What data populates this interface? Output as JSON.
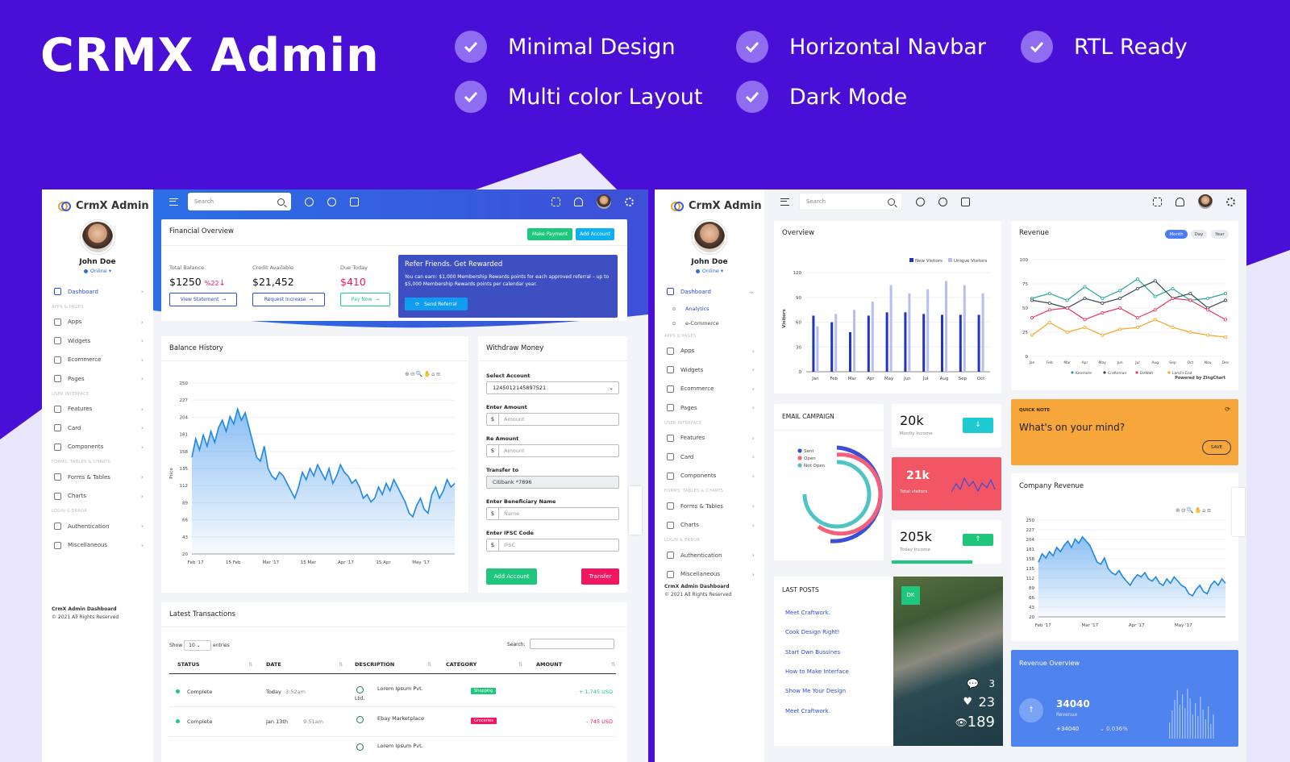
{
  "hero": {
    "title": "CRMX Admin",
    "features": [
      "Minimal Design",
      "Horizontal Navbar",
      "RTL Ready",
      "Multi color Layout",
      "Dark Mode"
    ]
  },
  "colors": {
    "brand": "#4a0fd6",
    "primary": "#2b4fd6",
    "success": "#1fc77e",
    "danger": "#f2155f",
    "info": "#0fb0f0"
  },
  "left": {
    "logo": "CrmX Admin",
    "user": {
      "name": "John Doe",
      "status": "Online ▾"
    },
    "search_placeholder": "Search",
    "nav": [
      {
        "label": "Dashboard",
        "active": true,
        "icon": "monitor-icon"
      },
      {
        "section": "APPS & PAGES"
      },
      {
        "label": "Apps",
        "icon": "grid-icon"
      },
      {
        "label": "Widgets",
        "icon": "edit-icon"
      },
      {
        "label": "Ecommerce",
        "icon": "cart-icon"
      },
      {
        "label": "Pages",
        "icon": "pages-icon"
      },
      {
        "section": "USER INTERFACE"
      },
      {
        "label": "Features",
        "icon": "box-icon"
      },
      {
        "label": "Card",
        "icon": "card-icon"
      },
      {
        "label": "Components",
        "icon": "eye-icon"
      },
      {
        "section": "FORMS, TABLES & CHARTS"
      },
      {
        "label": "Forms & Tables",
        "icon": "stack-icon"
      },
      {
        "label": "Charts",
        "icon": "pie-icon"
      },
      {
        "section": "LOGIN & ERROR"
      },
      {
        "label": "Authentication",
        "icon": "lock-icon"
      },
      {
        "label": "Miscellaneous",
        "icon": "warning-icon"
      }
    ],
    "footer": {
      "title": "CrmX Admin Dashboard",
      "copy": "© 2021 All Rights Reserved"
    },
    "financial": {
      "title": "Financial Overview",
      "make_payment": "Make Payment",
      "add_account": "Add Account",
      "total_label": "Total Balance",
      "total_value": "$1250",
      "total_change": "%22",
      "credit_label": "Credit Available",
      "credit_value": "$21,452",
      "due_label": "Due Today",
      "due_value": "$410",
      "view_statement": "View Statement",
      "request_increase": "Request Increase",
      "pay_now": "Pay Now"
    },
    "refer": {
      "title": "Refer Friends. Get Rewarded",
      "text": "You can earn: $1,000 Membership Rewards points for each approved referral – up to $5,000 Membership Rewards points per calendar year.",
      "button": "Send Referral"
    },
    "balance": {
      "title": "Balance History",
      "ylabel": "Price"
    },
    "withdraw": {
      "title": "Withdraw Money",
      "select_label": "Select Account",
      "select_value": "1245012145897521",
      "amount_label": "Enter Amount",
      "amount_ph": "Amount",
      "reamount_label": "Re Amount",
      "reamount_ph": "Amount",
      "transfer_label": "Transfer to",
      "transfer_value": "Citibank *7896",
      "beneficiary_label": "Enter Beneficiary Name",
      "beneficiary_ph": "Name",
      "ifsc_label": "Enter IFSC Code",
      "ifsc_ph": "IFSC",
      "add_btn": "Add Account",
      "transfer_btn": "Transfer",
      "currency": "$"
    },
    "transactions": {
      "title": "Latest Transactions",
      "show": "Show",
      "entries": "entries",
      "page_size": "10",
      "search_label": "Search:",
      "headers": [
        "STATUS",
        "DATE",
        "DESCRIPTION",
        "CATEGORY",
        "AMOUNT"
      ],
      "rows": [
        {
          "status": "Complete",
          "date": "Today",
          "time": "3:52am",
          "desc": "Lorem Ipsum Pvt.",
          "desc2": "Ltd.",
          "cat": "Shopping",
          "amount": "+ 1,745 USD"
        },
        {
          "status": "Complete",
          "date": "Jan 13th",
          "time": "9:51am",
          "desc": "Ebay Marketplace",
          "cat": "Groceries",
          "amount": "- 745 USD"
        },
        {
          "desc": "Lorem Ipsum Pvt."
        }
      ]
    }
  },
  "right": {
    "logo": "CrmX Admin",
    "user": {
      "name": "John Doe",
      "status": "Online ▾"
    },
    "search_placeholder": "Search",
    "nav": [
      {
        "label": "Dashboard",
        "active": true,
        "icon": "monitor-icon",
        "expanded": true
      },
      {
        "sub": "Analytics",
        "active": true
      },
      {
        "sub": "e-Commerce"
      },
      {
        "section": "APPS & PAGES"
      },
      {
        "label": "Apps",
        "icon": "grid-icon"
      },
      {
        "label": "Widgets",
        "icon": "edit-icon"
      },
      {
        "label": "Ecommerce",
        "icon": "cart-icon"
      },
      {
        "label": "Pages",
        "icon": "pages-icon"
      },
      {
        "section": "USER INTERFACE"
      },
      {
        "label": "Features",
        "icon": "box-icon"
      },
      {
        "label": "Card",
        "icon": "card-icon"
      },
      {
        "label": "Components",
        "icon": "eye-icon"
      },
      {
        "section": "FORMS, TABLES & CHARTS"
      },
      {
        "label": "Forms & Tables",
        "icon": "stack-icon"
      },
      {
        "label": "Charts",
        "icon": "pie-icon"
      },
      {
        "section": "LOGIN & ERROR"
      },
      {
        "label": "Authentication",
        "icon": "lock-icon"
      },
      {
        "label": "Miscellaneous",
        "icon": "warning-icon"
      }
    ],
    "footer": {
      "title": "CrmX Admin Dashboard",
      "copy": "© 2021 All Rights Reserved"
    },
    "overview": {
      "title": "Overview",
      "legend": [
        "New Visitors",
        "Unique Visitors"
      ],
      "ylabel": "Visitors"
    },
    "revenue": {
      "title": "Revenue",
      "tabs": [
        "Month",
        "Day",
        "Year"
      ],
      "legend": [
        "Kenmore",
        "Craftsman",
        "DeWalt",
        "Land's End"
      ],
      "powered": "Powered by ZingChart"
    },
    "email": {
      "title": "EMAIL CAMPAIGN",
      "legend": [
        "Sent",
        "Open",
        "Not Open"
      ]
    },
    "stats": [
      {
        "value": "20k",
        "label": "Montly Income"
      },
      {
        "value": "21k",
        "label": "Total visitors"
      },
      {
        "value": "205k",
        "label": "Today Income"
      }
    ],
    "quick": {
      "title": "QUICK NOTE",
      "text": "What's on your mind?",
      "button": "SAVE"
    },
    "company": {
      "title": "Company Revenue"
    },
    "posts": {
      "title": "LAST POSTS",
      "items": [
        "Meet Craftwork.",
        "Cook Design Right!",
        "Start Own Bussines",
        "How to Make Interface",
        "Show Me Your Design",
        "Meet Craftwork."
      ]
    },
    "photo": {
      "badge": "DK",
      "comments": "3",
      "likes": "23",
      "views": "189"
    },
    "rev_overview": {
      "title": "Revenue Overview",
      "value": "34040",
      "label": "Revenue",
      "delta": "+34040",
      "pct": "0.036%"
    }
  },
  "chart_data": [
    {
      "type": "area",
      "id": "balance-history",
      "title": "Balance History",
      "ylabel": "Price",
      "x_ticks": [
        "Feb '17",
        "15 Feb",
        "Mar '17",
        "15 Mar",
        "Apr '17",
        "15 Apr",
        "May '17"
      ],
      "y_ticks": [
        20,
        43,
        66,
        89,
        112,
        135,
        158,
        181,
        204,
        227,
        250
      ],
      "ylim": [
        20,
        250
      ],
      "values": [
        150,
        175,
        160,
        180,
        165,
        185,
        170,
        190,
        200,
        185,
        205,
        195,
        215,
        200,
        210,
        190,
        170,
        150,
        145,
        165,
        135,
        125,
        120,
        130,
        125,
        115,
        105,
        95,
        110,
        130,
        120,
        135,
        125,
        140,
        130,
        120,
        135,
        115,
        125,
        140,
        130,
        125,
        115,
        120,
        110,
        95,
        100,
        90,
        95,
        110,
        100,
        115,
        105,
        120,
        110,
        100,
        90,
        75,
        70,
        85,
        95,
        80,
        75,
        100,
        110,
        95,
        105,
        120,
        110,
        115
      ]
    },
    {
      "type": "bar",
      "id": "overview",
      "title": "Overview",
      "ylabel": "Visitors",
      "categories": [
        "Jan",
        "Feb",
        "Mar",
        "Apr",
        "May",
        "Jun",
        "Jul",
        "Aug",
        "Sep",
        "Oct"
      ],
      "series": [
        {
          "name": "New Visitors",
          "values": [
            68,
            60,
            48,
            68,
            72,
            72,
            70,
            69,
            69,
            69
          ]
        },
        {
          "name": "Unique Visitors",
          "values": [
            55,
            70,
            75,
            85,
            105,
            95,
            100,
            110,
            105,
            95
          ]
        }
      ],
      "y_ticks": [
        0,
        30,
        60,
        90,
        120
      ],
      "ylim": [
        0,
        130
      ]
    },
    {
      "type": "line",
      "id": "revenue",
      "title": "Revenue",
      "categories": [
        "Jan",
        "Feb",
        "Mar",
        "Apr",
        "May",
        "Jun",
        "Jul",
        "Aug",
        "Sep",
        "Oct",
        "Nov",
        "Dec"
      ],
      "series": [
        {
          "name": "Kenmore",
          "values": [
            60,
            65,
            58,
            72,
            60,
            68,
            80,
            62,
            70,
            58,
            60,
            65
          ]
        },
        {
          "name": "Craftsman",
          "values": [
            58,
            55,
            50,
            60,
            55,
            60,
            70,
            78,
            60,
            65,
            50,
            58
          ]
        },
        {
          "name": "DeWalt",
          "values": [
            40,
            48,
            50,
            38,
            45,
            50,
            40,
            48,
            60,
            58,
            48,
            38
          ]
        },
        {
          "name": "Land's End",
          "values": [
            22,
            35,
            25,
            30,
            22,
            28,
            30,
            38,
            30,
            25,
            22,
            20
          ]
        }
      ],
      "y_ticks": [
        0,
        25,
        50,
        75,
        100
      ],
      "ylim": [
        0,
        100
      ]
    },
    {
      "type": "area",
      "id": "company-revenue",
      "title": "Company Revenue",
      "x_ticks": [
        "Feb '17",
        "Mar '17",
        "Apr '17",
        "May '17"
      ],
      "y_ticks": [
        20,
        43,
        66,
        89,
        112,
        135,
        158,
        181,
        204,
        227,
        250
      ],
      "ylim": [
        20,
        250
      ],
      "values": [
        150,
        170,
        160,
        175,
        165,
        185,
        175,
        190,
        200,
        185,
        205,
        195,
        210,
        200,
        190,
        170,
        150,
        145,
        160,
        135,
        125,
        120,
        130,
        115,
        105,
        95,
        110,
        120,
        115,
        125,
        110,
        105,
        115,
        100,
        95,
        110,
        100,
        115,
        105,
        95,
        90,
        75,
        70,
        85,
        95,
        80,
        75,
        95,
        105,
        95,
        110,
        100
      ]
    }
  ]
}
